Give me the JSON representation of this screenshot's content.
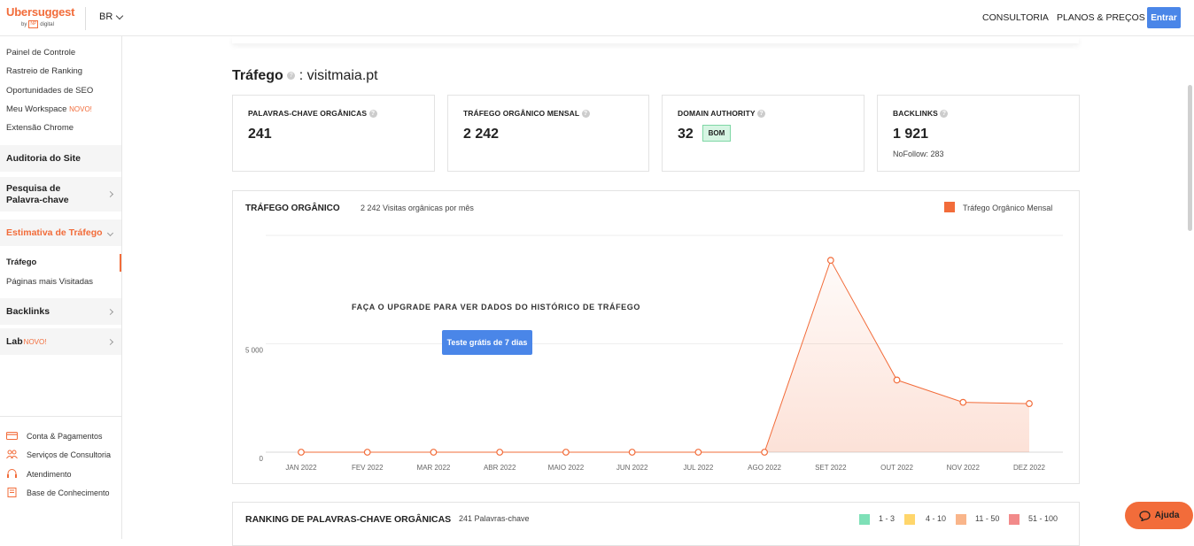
{
  "header": {
    "brand": "Ubersuggest",
    "by": "by",
    "np": "NP",
    "digital": "digital",
    "lang": "BR",
    "nav": [
      "CONSULTORIA",
      "PLANOS & PREÇOS"
    ],
    "login": "Entrar"
  },
  "sidebar": {
    "top_items": [
      "Painel de Controle",
      "Rastreio de Ranking",
      "Oportunidades de SEO",
      "Meu Workspace",
      "Extensão Chrome"
    ],
    "novo": "NOVO!",
    "sections": {
      "audit": "Auditoria do Site",
      "keyword": "Pesquisa de Palavra-chave",
      "traffic": "Estimativa de Tráfego",
      "backlinks": "Backlinks",
      "lab": "Lab"
    },
    "traffic_sub": [
      "Tráfego",
      "Páginas mais Visitadas"
    ],
    "bottom_items": [
      "Conta & Pagamentos",
      "Serviços de Consultoria",
      "Atendimento",
      "Base de Conhecimento"
    ]
  },
  "page": {
    "title_label": "Tráfego",
    "title_sep": " : ",
    "domain": "visitmaia.pt"
  },
  "cards": [
    {
      "label": "PALAVRAS-CHAVE ORGÂNICAS",
      "value": "241"
    },
    {
      "label": "TRÁFEGO ORGÂNICO MENSAL",
      "value": "2 242"
    },
    {
      "label": "DOMAIN AUTHORITY",
      "value": "32",
      "badge": "BOM"
    },
    {
      "label": "BACKLINKS",
      "value": "1 921",
      "sub": "NoFollow: 283"
    }
  ],
  "traffic_panel": {
    "title": "TRÁFEGO ORGÂNICO",
    "subtitle": "2 242 Visitas orgânicas por mês",
    "upgrade_text": "FAÇA O UPGRADE PARA VER DADOS DO HISTÓRICO DE TRÁFEGO",
    "trial_button": "Teste grátis de 7 dias"
  },
  "ranking_panel": {
    "title": "RANKING DE PALAVRAS-CHAVE ORGÂNICAS",
    "subtitle": "241 Palavras-chave",
    "legend": [
      {
        "label": "1 - 3",
        "color": "#7ee0b7"
      },
      {
        "label": "4 - 10",
        "color": "#ffd66b"
      },
      {
        "label": "11 - 50",
        "color": "#f9b58a"
      },
      {
        "label": "51 - 100",
        "color": "#f28a8a"
      }
    ]
  },
  "help": {
    "label": "Ajuda"
  },
  "colors": {
    "accent": "#f26c3a",
    "blue": "#4a86e8"
  },
  "chart_data": {
    "type": "area",
    "categories": [
      "JAN 2022",
      "FEV 2022",
      "MAR 2022",
      "ABR 2022",
      "MAIO 2022",
      "JUN 2022",
      "JUL 2022",
      "AGO 2022",
      "SET 2022",
      "OUT 2022",
      "NOV 2022",
      "DEZ 2022"
    ],
    "series": [
      {
        "name": "Tráfego Orgânico Mensal",
        "values": [
          0,
          0,
          0,
          0,
          0,
          0,
          0,
          0,
          8850,
          3330,
          2300,
          2242
        ],
        "color": "#f26c3a"
      }
    ],
    "yticks": [
      "0",
      "5 000"
    ],
    "ylim": [
      0,
      10000
    ],
    "grid": true,
    "legend": "top-right"
  }
}
